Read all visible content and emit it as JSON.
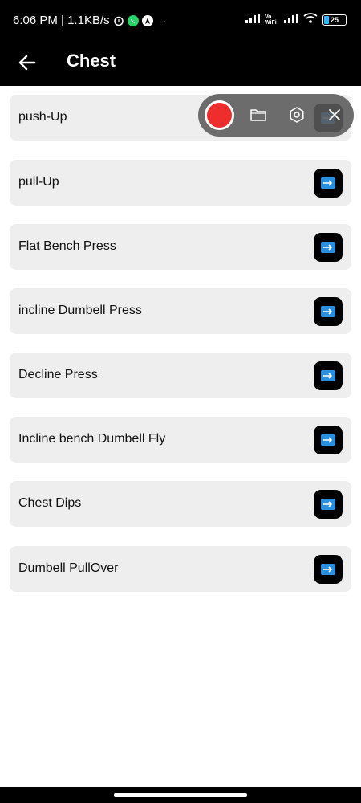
{
  "status_bar": {
    "time_speed": "6:06 PM | 1.1KB/s",
    "battery": "25",
    "network_label": "Vo WiFi"
  },
  "app_bar": {
    "title": "Chest"
  },
  "exercises": [
    {
      "label": "push-Up"
    },
    {
      "label": "pull-Up"
    },
    {
      "label": "Flat Bench Press"
    },
    {
      "label": "incline Dumbell Press"
    },
    {
      "label": "Decline Press"
    },
    {
      "label": "Incline bench Dumbell Fly"
    },
    {
      "label": "Chest Dips"
    },
    {
      "label": "Dumbell PullOver"
    }
  ],
  "colors": {
    "record_red": "#ee2d2d",
    "arrow_blue": "#2b8fe0",
    "item_background": "#eeeeee"
  }
}
